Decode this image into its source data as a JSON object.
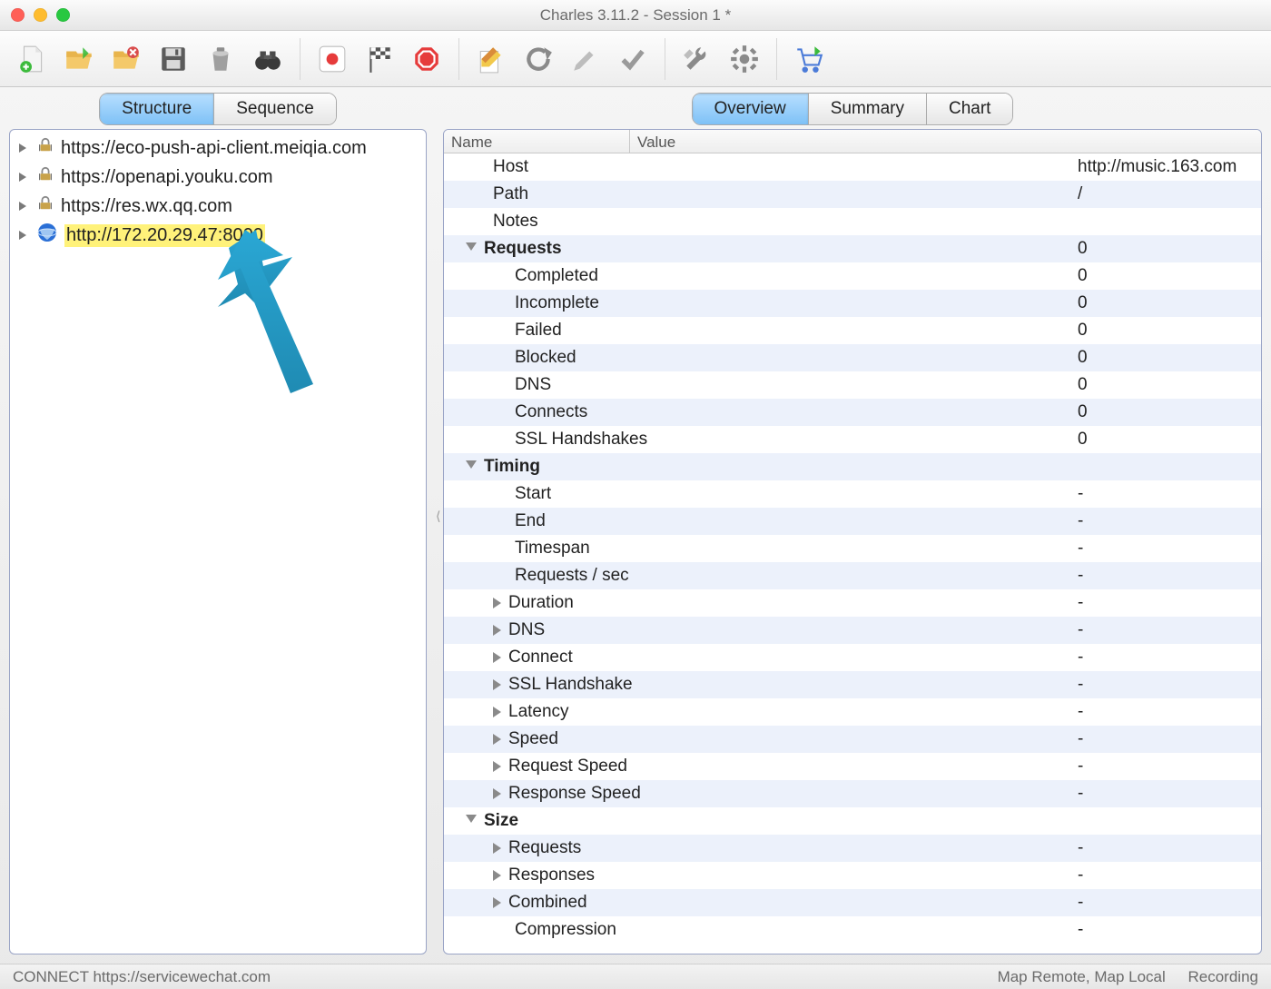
{
  "window": {
    "title": "Charles 3.11.2 - Session 1 *"
  },
  "leftTabs": {
    "structure": "Structure",
    "sequence": "Sequence",
    "active": "structure"
  },
  "rightTabs": {
    "overview": "Overview",
    "summary": "Summary",
    "chart": "Chart",
    "active": "overview"
  },
  "treeHosts": [
    {
      "label": "https://eco-push-api-client.meiqia.com",
      "icon": "lock"
    },
    {
      "label": "https://openapi.youku.com",
      "icon": "lock"
    },
    {
      "label": "https://res.wx.qq.com",
      "icon": "lock"
    },
    {
      "label": "http://172.20.29.47:8000",
      "icon": "globe",
      "highlight": true
    }
  ],
  "kvHeader": {
    "name": "Name",
    "value": "Value"
  },
  "kvRows": [
    {
      "indent": 1,
      "name": "Host",
      "value": "http://music.163.com"
    },
    {
      "indent": 1,
      "name": "Path",
      "value": "/"
    },
    {
      "indent": 1,
      "name": "Notes",
      "value": ""
    },
    {
      "indent": 0,
      "tri": "down",
      "bold": true,
      "name": "Requests",
      "value": "0"
    },
    {
      "indent": 2,
      "name": "Completed",
      "value": "0"
    },
    {
      "indent": 2,
      "name": "Incomplete",
      "value": "0"
    },
    {
      "indent": 2,
      "name": "Failed",
      "value": "0"
    },
    {
      "indent": 2,
      "name": "Blocked",
      "value": "0"
    },
    {
      "indent": 2,
      "name": "DNS",
      "value": "0"
    },
    {
      "indent": 2,
      "name": "Connects",
      "value": "0"
    },
    {
      "indent": 2,
      "name": "SSL Handshakes",
      "value": "0"
    },
    {
      "indent": 0,
      "tri": "down",
      "bold": true,
      "name": "Timing",
      "value": ""
    },
    {
      "indent": 2,
      "name": "Start",
      "value": "-"
    },
    {
      "indent": 2,
      "name": "End",
      "value": "-"
    },
    {
      "indent": 2,
      "name": "Timespan",
      "value": "-"
    },
    {
      "indent": 2,
      "name": "Requests / sec",
      "value": "-"
    },
    {
      "indent": 1,
      "tri": "right",
      "name": "Duration",
      "value": "-"
    },
    {
      "indent": 1,
      "tri": "right",
      "name": "DNS",
      "value": "-"
    },
    {
      "indent": 1,
      "tri": "right",
      "name": "Connect",
      "value": "-"
    },
    {
      "indent": 1,
      "tri": "right",
      "name": "SSL Handshake",
      "value": "-"
    },
    {
      "indent": 1,
      "tri": "right",
      "name": "Latency",
      "value": "-"
    },
    {
      "indent": 1,
      "tri": "right",
      "name": "Speed",
      "value": "-"
    },
    {
      "indent": 1,
      "tri": "right",
      "name": "Request Speed",
      "value": "-"
    },
    {
      "indent": 1,
      "tri": "right",
      "name": "Response Speed",
      "value": "-"
    },
    {
      "indent": 0,
      "tri": "down",
      "bold": true,
      "name": "Size",
      "value": ""
    },
    {
      "indent": 1,
      "tri": "right",
      "name": "Requests",
      "value": "-"
    },
    {
      "indent": 1,
      "tri": "right",
      "name": "Responses",
      "value": "-"
    },
    {
      "indent": 1,
      "tri": "right",
      "name": "Combined",
      "value": "-"
    },
    {
      "indent": 2,
      "name": "Compression",
      "value": "-"
    }
  ],
  "status": {
    "left": "CONNECT https://servicewechat.com",
    "right": [
      "Map Remote, Map Local",
      "Recording"
    ]
  },
  "colors": {
    "accent": "#2aa7d4",
    "highlight": "#fff27a"
  }
}
